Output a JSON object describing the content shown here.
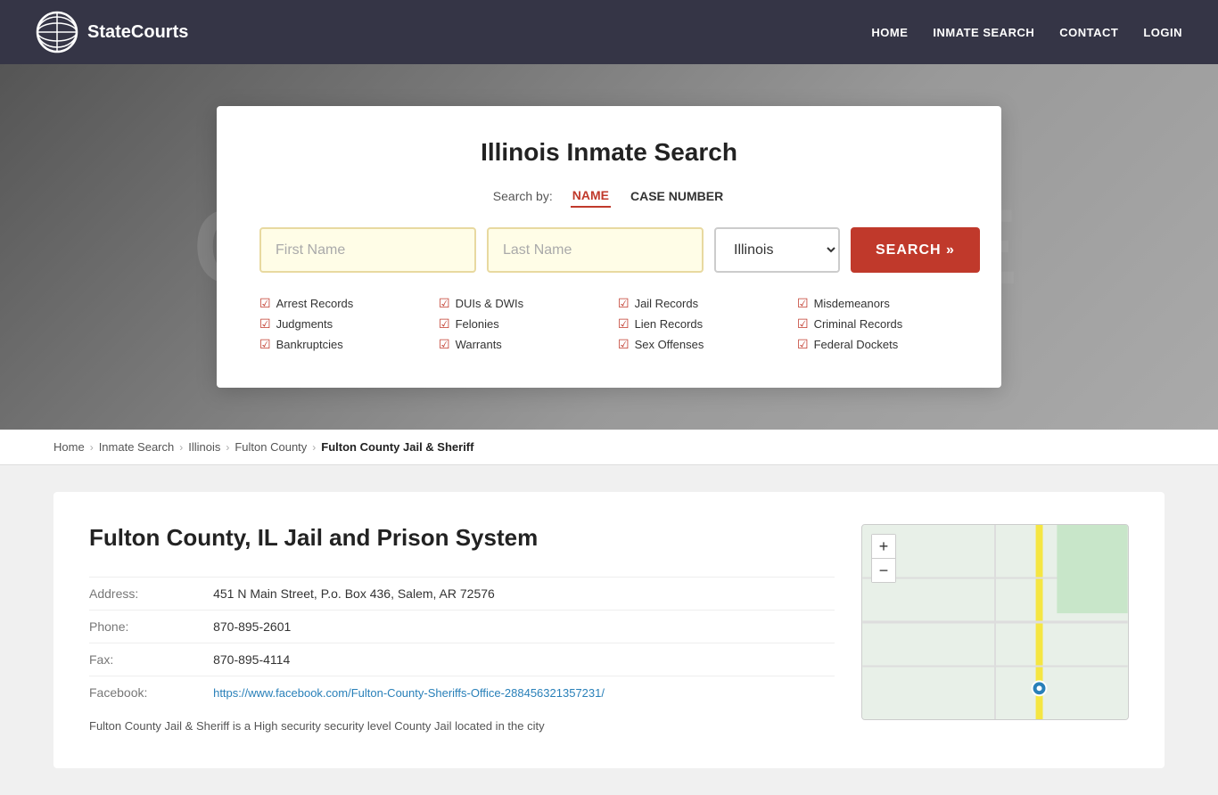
{
  "header": {
    "logo_text": "StateCourts",
    "nav": {
      "home": "HOME",
      "inmate_search": "INMATE SEARCH",
      "contact": "CONTACT",
      "login": "LOGIN"
    }
  },
  "hero": {
    "bg_text": "COURTHOUSE"
  },
  "search_card": {
    "title": "Illinois Inmate Search",
    "search_by_label": "Search by:",
    "tab_name": "NAME",
    "tab_case_number": "CASE NUMBER",
    "first_name_placeholder": "First Name",
    "last_name_placeholder": "Last Name",
    "state_value": "Illinois",
    "search_button": "SEARCH »",
    "checkboxes": [
      {
        "label": "Arrest Records"
      },
      {
        "label": "DUIs & DWIs"
      },
      {
        "label": "Jail Records"
      },
      {
        "label": "Misdemeanors"
      },
      {
        "label": "Judgments"
      },
      {
        "label": "Felonies"
      },
      {
        "label": "Lien Records"
      },
      {
        "label": "Criminal Records"
      },
      {
        "label": "Bankruptcies"
      },
      {
        "label": "Warrants"
      },
      {
        "label": "Sex Offenses"
      },
      {
        "label": "Federal Dockets"
      }
    ]
  },
  "breadcrumb": {
    "items": [
      {
        "label": "Home",
        "link": true
      },
      {
        "label": "Inmate Search",
        "link": true
      },
      {
        "label": "Illinois",
        "link": true
      },
      {
        "label": "Fulton County",
        "link": true
      },
      {
        "label": "Fulton County Jail & Sheriff",
        "link": false
      }
    ]
  },
  "content": {
    "heading": "Fulton County, IL Jail and Prison System",
    "address_label": "Address:",
    "address_value": "451 N Main Street, P.o. Box 436, Salem, AR 72576",
    "phone_label": "Phone:",
    "phone_value": "870-895-2601",
    "fax_label": "Fax:",
    "fax_value": "870-895-4114",
    "facebook_label": "Facebook:",
    "facebook_url": "https://www.facebook.com/Fulton-County-Sheriffs-Office-288456321357231/",
    "facebook_display": "https://www.facebook.com/Fulton-County-Sheriffs-Office-288456321357231/",
    "description": "Fulton County Jail & Sheriff is a High security security level County Jail located in the city"
  },
  "map": {
    "zoom_in": "+",
    "zoom_out": "−"
  }
}
